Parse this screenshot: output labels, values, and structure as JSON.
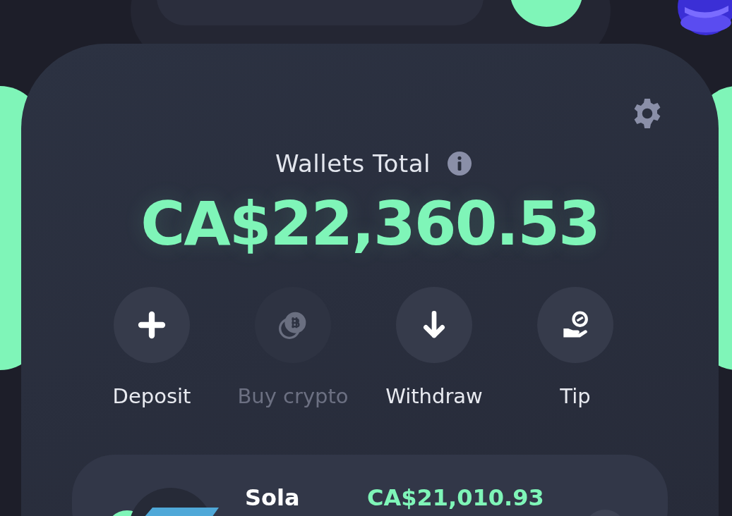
{
  "wallet_summary": {
    "title": "Wallets Total",
    "total": "CA$22,360.53"
  },
  "actions": [
    {
      "kind": "deposit",
      "label": "Deposit",
      "disabled": false
    },
    {
      "kind": "buy",
      "label": "Buy crypto",
      "disabled": true
    },
    {
      "kind": "withdraw",
      "label": "Withdraw",
      "disabled": false
    },
    {
      "kind": "tip",
      "label": "Tip",
      "disabled": false
    }
  ],
  "wallets": [
    {
      "name": "Sola",
      "amount": "CA$21,010.93"
    }
  ]
}
